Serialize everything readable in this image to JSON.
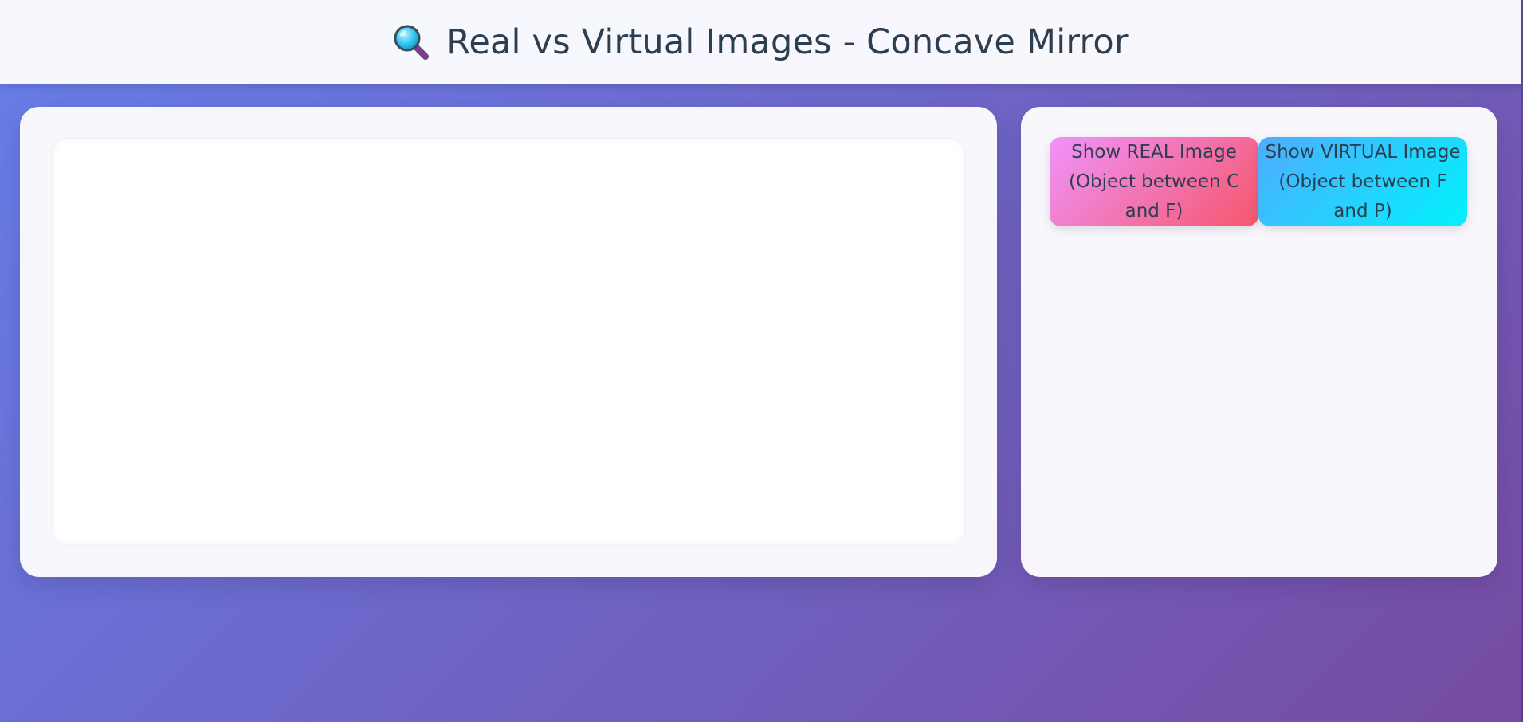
{
  "header": {
    "icon": "magnifying-glass-icon",
    "title": "Real vs Virtual Images - Concave Mirror"
  },
  "controls": {
    "real_button_label": "Show REAL Image (Object between C and F)",
    "virtual_button_label": "Show VIRTUAL Image (Object between F and P)"
  },
  "colors": {
    "background_start": "#667eea",
    "background_end": "#764ba2",
    "real_button_start": "#f093fb",
    "real_button_end": "#f5576c",
    "virtual_button_start": "#4facfe",
    "virtual_button_end": "#00f2fe",
    "text": "#2c3e50"
  }
}
